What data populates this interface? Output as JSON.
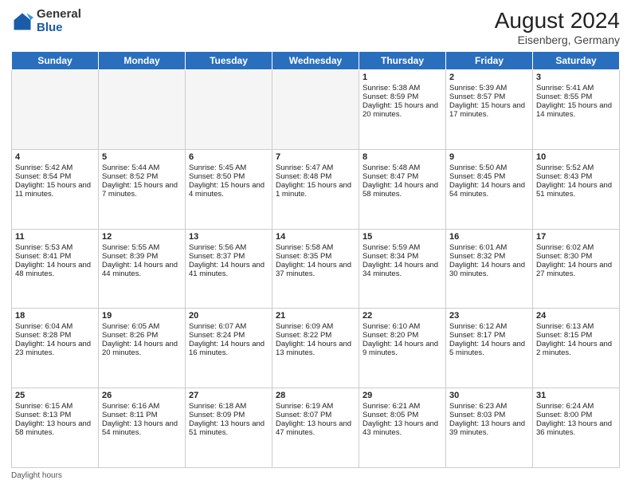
{
  "header": {
    "logo_general": "General",
    "logo_blue": "Blue",
    "month_year": "August 2024",
    "location": "Eisenberg, Germany"
  },
  "footer": {
    "daylight_label": "Daylight hours"
  },
  "days_of_week": [
    "Sunday",
    "Monday",
    "Tuesday",
    "Wednesday",
    "Thursday",
    "Friday",
    "Saturday"
  ],
  "weeks": [
    [
      {
        "day": "",
        "info": ""
      },
      {
        "day": "",
        "info": ""
      },
      {
        "day": "",
        "info": ""
      },
      {
        "day": "",
        "info": ""
      },
      {
        "day": "1",
        "info": "Sunrise: 5:38 AM\nSunset: 8:59 PM\nDaylight: 15 hours and 20 minutes."
      },
      {
        "day": "2",
        "info": "Sunrise: 5:39 AM\nSunset: 8:57 PM\nDaylight: 15 hours and 17 minutes."
      },
      {
        "day": "3",
        "info": "Sunrise: 5:41 AM\nSunset: 8:55 PM\nDaylight: 15 hours and 14 minutes."
      }
    ],
    [
      {
        "day": "4",
        "info": "Sunrise: 5:42 AM\nSunset: 8:54 PM\nDaylight: 15 hours and 11 minutes."
      },
      {
        "day": "5",
        "info": "Sunrise: 5:44 AM\nSunset: 8:52 PM\nDaylight: 15 hours and 7 minutes."
      },
      {
        "day": "6",
        "info": "Sunrise: 5:45 AM\nSunset: 8:50 PM\nDaylight: 15 hours and 4 minutes."
      },
      {
        "day": "7",
        "info": "Sunrise: 5:47 AM\nSunset: 8:48 PM\nDaylight: 15 hours and 1 minute."
      },
      {
        "day": "8",
        "info": "Sunrise: 5:48 AM\nSunset: 8:47 PM\nDaylight: 14 hours and 58 minutes."
      },
      {
        "day": "9",
        "info": "Sunrise: 5:50 AM\nSunset: 8:45 PM\nDaylight: 14 hours and 54 minutes."
      },
      {
        "day": "10",
        "info": "Sunrise: 5:52 AM\nSunset: 8:43 PM\nDaylight: 14 hours and 51 minutes."
      }
    ],
    [
      {
        "day": "11",
        "info": "Sunrise: 5:53 AM\nSunset: 8:41 PM\nDaylight: 14 hours and 48 minutes."
      },
      {
        "day": "12",
        "info": "Sunrise: 5:55 AM\nSunset: 8:39 PM\nDaylight: 14 hours and 44 minutes."
      },
      {
        "day": "13",
        "info": "Sunrise: 5:56 AM\nSunset: 8:37 PM\nDaylight: 14 hours and 41 minutes."
      },
      {
        "day": "14",
        "info": "Sunrise: 5:58 AM\nSunset: 8:35 PM\nDaylight: 14 hours and 37 minutes."
      },
      {
        "day": "15",
        "info": "Sunrise: 5:59 AM\nSunset: 8:34 PM\nDaylight: 14 hours and 34 minutes."
      },
      {
        "day": "16",
        "info": "Sunrise: 6:01 AM\nSunset: 8:32 PM\nDaylight: 14 hours and 30 minutes."
      },
      {
        "day": "17",
        "info": "Sunrise: 6:02 AM\nSunset: 8:30 PM\nDaylight: 14 hours and 27 minutes."
      }
    ],
    [
      {
        "day": "18",
        "info": "Sunrise: 6:04 AM\nSunset: 8:28 PM\nDaylight: 14 hours and 23 minutes."
      },
      {
        "day": "19",
        "info": "Sunrise: 6:05 AM\nSunset: 8:26 PM\nDaylight: 14 hours and 20 minutes."
      },
      {
        "day": "20",
        "info": "Sunrise: 6:07 AM\nSunset: 8:24 PM\nDaylight: 14 hours and 16 minutes."
      },
      {
        "day": "21",
        "info": "Sunrise: 6:09 AM\nSunset: 8:22 PM\nDaylight: 14 hours and 13 minutes."
      },
      {
        "day": "22",
        "info": "Sunrise: 6:10 AM\nSunset: 8:20 PM\nDaylight: 14 hours and 9 minutes."
      },
      {
        "day": "23",
        "info": "Sunrise: 6:12 AM\nSunset: 8:17 PM\nDaylight: 14 hours and 5 minutes."
      },
      {
        "day": "24",
        "info": "Sunrise: 6:13 AM\nSunset: 8:15 PM\nDaylight: 14 hours and 2 minutes."
      }
    ],
    [
      {
        "day": "25",
        "info": "Sunrise: 6:15 AM\nSunset: 8:13 PM\nDaylight: 13 hours and 58 minutes."
      },
      {
        "day": "26",
        "info": "Sunrise: 6:16 AM\nSunset: 8:11 PM\nDaylight: 13 hours and 54 minutes."
      },
      {
        "day": "27",
        "info": "Sunrise: 6:18 AM\nSunset: 8:09 PM\nDaylight: 13 hours and 51 minutes."
      },
      {
        "day": "28",
        "info": "Sunrise: 6:19 AM\nSunset: 8:07 PM\nDaylight: 13 hours and 47 minutes."
      },
      {
        "day": "29",
        "info": "Sunrise: 6:21 AM\nSunset: 8:05 PM\nDaylight: 13 hours and 43 minutes."
      },
      {
        "day": "30",
        "info": "Sunrise: 6:23 AM\nSunset: 8:03 PM\nDaylight: 13 hours and 39 minutes."
      },
      {
        "day": "31",
        "info": "Sunrise: 6:24 AM\nSunset: 8:00 PM\nDaylight: 13 hours and 36 minutes."
      }
    ]
  ]
}
